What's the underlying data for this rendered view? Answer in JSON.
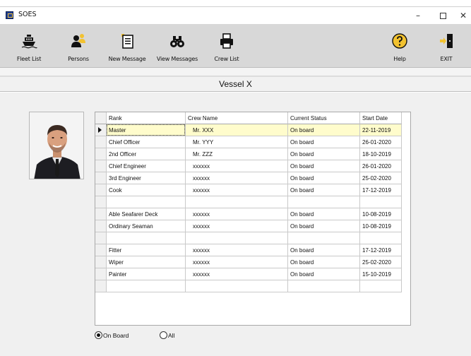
{
  "window": {
    "title": "SOES",
    "minimize_glyph": "–",
    "close_glyph": "✕"
  },
  "toolbar": {
    "fleet_list": {
      "label": "Fleet List",
      "icon": "ship-icon"
    },
    "persons": {
      "label": "Persons",
      "icon": "persons-icon"
    },
    "new_message": {
      "label": "New Message",
      "icon": "new-document-icon"
    },
    "view_messages": {
      "label": "View Messages",
      "icon": "binoculars-icon"
    },
    "crew_list": {
      "label": "Crew List",
      "icon": "printer-icon"
    },
    "help": {
      "label": "Help",
      "icon": "help-icon"
    },
    "exit": {
      "label": "EXIT",
      "icon": "exit-door-icon"
    }
  },
  "vessel": {
    "title": "Vessel X"
  },
  "crew_table": {
    "columns": [
      "Rank",
      "Crew Name",
      "Current Status",
      "Start Date"
    ],
    "rows": [
      {
        "rank": "Master",
        "name": "Mr. XXX",
        "status": "On board",
        "start": "22-11-2019"
      },
      {
        "rank": "Chief Officer",
        "name": "Mr. YYY",
        "status": "On board",
        "start": "26-01-2020"
      },
      {
        "rank": "2nd Officer",
        "name": "Mr. ZZZ",
        "status": "On board",
        "start": "18-10-2019"
      },
      {
        "rank": "Chief Engineer",
        "name": "xxxxxx",
        "status": "On board",
        "start": "26-01-2020"
      },
      {
        "rank": "3rd Engineer",
        "name": "xxxxxx",
        "status": "On board",
        "start": "25-02-2020"
      },
      {
        "rank": "Cook",
        "name": "xxxxxx",
        "status": "On board",
        "start": "17-12-2019"
      },
      {
        "rank": "",
        "name": "",
        "status": "",
        "start": ""
      },
      {
        "rank": "Able Seafarer Deck",
        "name": "xxxxxx",
        "status": "On board",
        "start": "10-08-2019"
      },
      {
        "rank": "Ordinary Seaman",
        "name": "xxxxxx",
        "status": "On board",
        "start": "10-08-2019"
      },
      {
        "rank": "",
        "name": "",
        "status": "",
        "start": ""
      },
      {
        "rank": "Fitter",
        "name": "xxxxxx",
        "status": "On board",
        "start": "17-12-2019"
      },
      {
        "rank": "Wiper",
        "name": "xxxxxx",
        "status": "On board",
        "start": "25-02-2020"
      },
      {
        "rank": "Painter",
        "name": "xxxxxx",
        "status": "On board",
        "start": "15-10-2019"
      },
      {
        "rank": "",
        "name": "",
        "status": "",
        "start": ""
      }
    ],
    "selected_row": 0
  },
  "filter": {
    "on_board_label": "On Board",
    "all_label": "All",
    "selected": "on_board"
  },
  "colors": {
    "toolbar_bg": "#d8d8d8",
    "selected_row_bg": "#fffccc",
    "content_bg": "#f0f0f0"
  }
}
